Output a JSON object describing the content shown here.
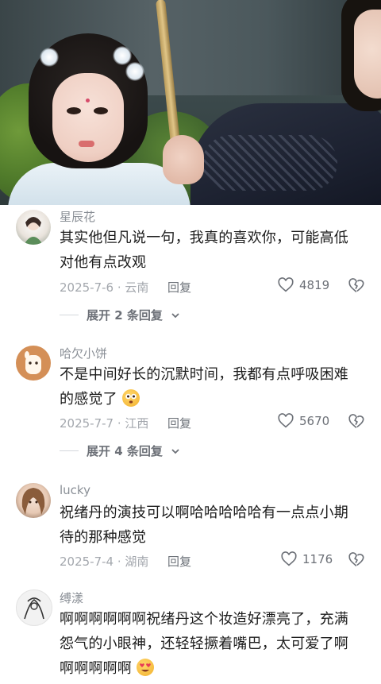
{
  "video": {
    "icon": "video-frame"
  },
  "comments": [
    {
      "username": "星辰花",
      "text": "其实他但凡说一句，我真的喜欢你，可能高低对他有点改观",
      "date_location": "2025-7-6 · 云南",
      "reply_label": "回复",
      "likes": "4819",
      "expand_label": "展开 2 条回复"
    },
    {
      "username": "哈欠小饼",
      "text": "不是中间好长的沉默时间，我都有点呼吸困难的感觉了",
      "emoji": "flushed-face-emoji",
      "date_location": "2025-7-7 · 江西",
      "reply_label": "回复",
      "likes": "5670",
      "expand_label": "展开 4 条回复"
    },
    {
      "username": "lucky",
      "text": "祝绪丹的演技可以啊哈哈哈哈哈有一点点小期待的那种感觉",
      "date_location": "2025-7-4 · 湖南",
      "reply_label": "回复",
      "likes": "1176"
    },
    {
      "username": "缚漾",
      "text": "啊啊啊啊啊啊祝绪丹这个妆造好漂亮了，充满怨气的小眼神，还轻轻撅着嘴巴，太可爱了啊啊啊啊啊啊",
      "emoji": "heart-eyes-emoji"
    }
  ],
  "colors": {
    "meta": "#a3a7ad",
    "text": "#1c1c1c",
    "username": "#8a8f96"
  }
}
